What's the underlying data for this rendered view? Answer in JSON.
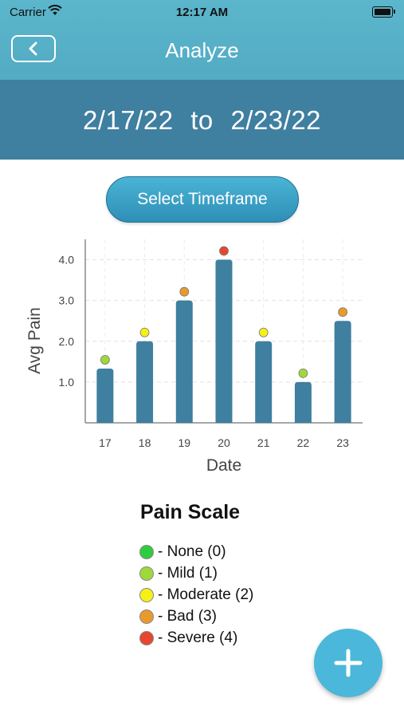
{
  "status_bar": {
    "carrier": "Carrier",
    "time": "12:17 AM"
  },
  "header": {
    "title": "Analyze",
    "back_icon": "chevron-left-icon"
  },
  "date_range": {
    "start": "2/17/22",
    "separator": "to",
    "end": "2/23/22"
  },
  "timeframe_button": {
    "label": "Select Timeframe"
  },
  "chart_data": {
    "type": "bar",
    "categories": [
      "17",
      "18",
      "19",
      "20",
      "21",
      "22",
      "23"
    ],
    "values": [
      1.33,
      2.0,
      3.0,
      4.0,
      2.0,
      1.0,
      2.5
    ],
    "marker_levels": [
      1,
      2,
      3,
      4,
      2,
      1,
      3
    ],
    "xlabel": "Date",
    "ylabel": "Avg Pain",
    "yticks": [
      "1.0",
      "2.0",
      "3.0",
      "4.0"
    ],
    "ylim": [
      0,
      4.5
    ],
    "grid": true,
    "bar_color": "#3f7fa0"
  },
  "legend": {
    "title": "Pain Scale",
    "items": [
      {
        "label": "- None (0)",
        "color": "#2ecc40"
      },
      {
        "label": "- Mild (1)",
        "color": "#9fd83b"
      },
      {
        "label": "- Moderate (2)",
        "color": "#f4f018"
      },
      {
        "label": "- Bad (3)",
        "color": "#e89a2c"
      },
      {
        "label": "- Severe (4)",
        "color": "#e6472e"
      }
    ]
  },
  "fab": {
    "icon": "plus-icon"
  }
}
